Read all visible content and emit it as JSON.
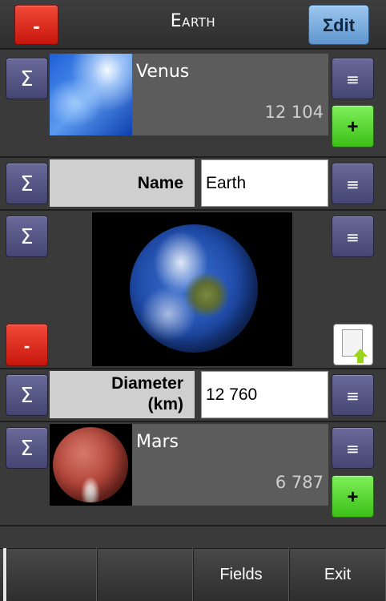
{
  "header": {
    "title": "Earth",
    "minus_label": "-",
    "edit_label": "Σdit"
  },
  "icons": {
    "sigma": "Σ",
    "menu": "≡",
    "plus": "+",
    "minus": "-"
  },
  "rows": {
    "venus": {
      "name": "Venus",
      "value": "12 104"
    },
    "name_field": {
      "label": "Name",
      "value": "Earth"
    },
    "image_field": {
      "delete_label": "-"
    },
    "diameter_field": {
      "label": "Diameter\n(km)",
      "value": "12 760"
    },
    "mars": {
      "name": "Mars",
      "value": "6 787"
    }
  },
  "tabs": [
    "",
    "",
    "Fields",
    "Exit"
  ],
  "colors": {
    "accent_red": "#d8251a",
    "accent_green": "#4fcd22",
    "accent_blue": "#7cb0e0",
    "button_purple": "#565688"
  }
}
